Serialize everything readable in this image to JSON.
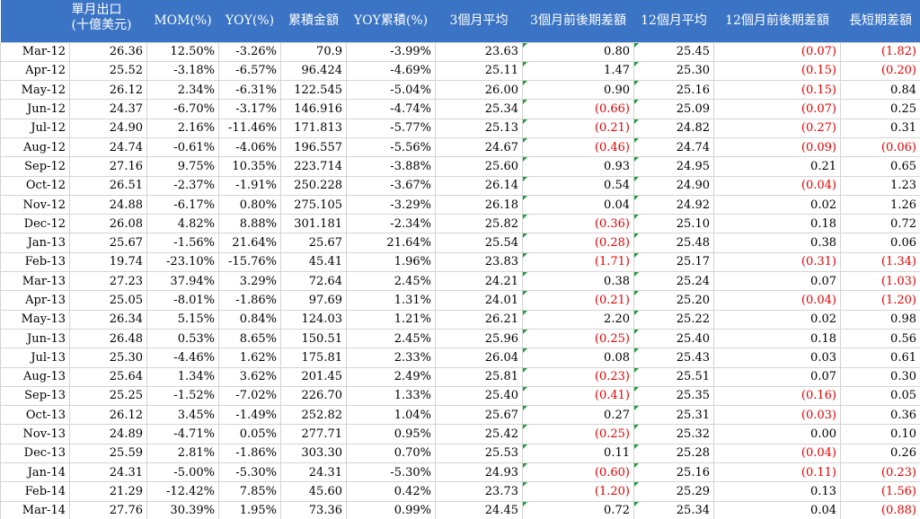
{
  "sheet": {
    "headers": [
      "",
      [
        "單月出口",
        "(十億美元)"
      ],
      "MOM(%)",
      "YOY(%)",
      "累積金額",
      "YOY累積(%)",
      "3個月平均",
      "3個月前後期差額",
      "12個月平均",
      "12個月前後期差額",
      "長短期差額"
    ],
    "colors": {
      "header_bg": "#3b74c4",
      "header_text": "#ffffff",
      "negative_text": "#e60000",
      "grid_line": "#d4d4d4",
      "error_flag": "#1f9d3a"
    },
    "rows": [
      [
        "Mar-12",
        "26.36",
        "12.50%",
        "-3.26%",
        "70.9",
        "-3.99%",
        "23.63",
        "0.80",
        "25.45",
        "(0.07)",
        "(1.82)"
      ],
      [
        "Apr-12",
        "25.52",
        "-3.18%",
        "-6.57%",
        "96.424",
        "-4.69%",
        "25.11",
        "1.47",
        "25.30",
        "(0.15)",
        "(0.20)"
      ],
      [
        "May-12",
        "26.12",
        "2.34%",
        "-6.31%",
        "122.545",
        "-5.04%",
        "26.00",
        "0.90",
        "25.16",
        "(0.15)",
        "0.84"
      ],
      [
        "Jun-12",
        "24.37",
        "-6.70%",
        "-3.17%",
        "146.916",
        "-4.74%",
        "25.34",
        "(0.66)",
        "25.09",
        "(0.07)",
        "0.25"
      ],
      [
        "Jul-12",
        "24.90",
        "2.16%",
        "-11.46%",
        "171.813",
        "-5.77%",
        "25.13",
        "(0.21)",
        "24.82",
        "(0.27)",
        "0.31"
      ],
      [
        "Aug-12",
        "24.74",
        "-0.61%",
        "-4.06%",
        "196.557",
        "-5.56%",
        "24.67",
        "(0.46)",
        "24.74",
        "(0.09)",
        "(0.06)"
      ],
      [
        "Sep-12",
        "27.16",
        "9.75%",
        "10.35%",
        "223.714",
        "-3.88%",
        "25.60",
        "0.93",
        "24.95",
        "0.21",
        "0.65"
      ],
      [
        "Oct-12",
        "26.51",
        "-2.37%",
        "-1.91%",
        "250.228",
        "-3.67%",
        "26.14",
        "0.54",
        "24.90",
        "(0.04)",
        "1.23"
      ],
      [
        "Nov-12",
        "24.88",
        "-6.17%",
        "0.80%",
        "275.105",
        "-3.29%",
        "26.18",
        "0.04",
        "24.92",
        "0.02",
        "1.26"
      ],
      [
        "Dec-12",
        "26.08",
        "4.82%",
        "8.88%",
        "301.181",
        "-2.34%",
        "25.82",
        "(0.36)",
        "25.10",
        "0.18",
        "0.72"
      ],
      [
        "Jan-13",
        "25.67",
        "-1.56%",
        "21.64%",
        "25.67",
        "21.64%",
        "25.54",
        "(0.28)",
        "25.48",
        "0.38",
        "0.06"
      ],
      [
        "Feb-13",
        "19.74",
        "-23.10%",
        "-15.76%",
        "45.41",
        "1.96%",
        "23.83",
        "(1.71)",
        "25.17",
        "(0.31)",
        "(1.34)"
      ],
      [
        "Mar-13",
        "27.23",
        "37.94%",
        "3.29%",
        "72.64",
        "2.45%",
        "24.21",
        "0.38",
        "25.24",
        "0.07",
        "(1.03)"
      ],
      [
        "Apr-13",
        "25.05",
        "-8.01%",
        "-1.86%",
        "97.69",
        "1.31%",
        "24.01",
        "(0.21)",
        "25.20",
        "(0.04)",
        "(1.20)"
      ],
      [
        "May-13",
        "26.34",
        "5.15%",
        "0.84%",
        "124.03",
        "1.21%",
        "26.21",
        "2.20",
        "25.22",
        "0.02",
        "0.98"
      ],
      [
        "Jun-13",
        "26.48",
        "0.53%",
        "8.65%",
        "150.51",
        "2.45%",
        "25.96",
        "(0.25)",
        "25.40",
        "0.18",
        "0.56"
      ],
      [
        "Jul-13",
        "25.30",
        "-4.46%",
        "1.62%",
        "175.81",
        "2.33%",
        "26.04",
        "0.08",
        "25.43",
        "0.03",
        "0.61"
      ],
      [
        "Aug-13",
        "25.64",
        "1.34%",
        "3.62%",
        "201.45",
        "2.49%",
        "25.81",
        "(0.23)",
        "25.51",
        "0.07",
        "0.30"
      ],
      [
        "Sep-13",
        "25.25",
        "-1.52%",
        "-7.02%",
        "226.70",
        "1.33%",
        "25.40",
        "(0.41)",
        "25.35",
        "(0.16)",
        "0.05"
      ],
      [
        "Oct-13",
        "26.12",
        "3.45%",
        "-1.49%",
        "252.82",
        "1.04%",
        "25.67",
        "0.27",
        "25.31",
        "(0.03)",
        "0.36"
      ],
      [
        "Nov-13",
        "24.89",
        "-4.71%",
        "0.05%",
        "277.71",
        "0.95%",
        "25.42",
        "(0.25)",
        "25.32",
        "0.00",
        "0.10"
      ],
      [
        "Dec-13",
        "25.59",
        "2.81%",
        "-1.86%",
        "303.30",
        "0.70%",
        "25.53",
        "0.11",
        "25.28",
        "(0.04)",
        "0.26"
      ],
      [
        "Jan-14",
        "24.31",
        "-5.00%",
        "-5.30%",
        "24.31",
        "-5.30%",
        "24.93",
        "(0.60)",
        "25.16",
        "(0.11)",
        "(0.23)"
      ],
      [
        "Feb-14",
        "21.29",
        "-12.42%",
        "7.85%",
        "45.60",
        "0.42%",
        "23.73",
        "(1.20)",
        "25.29",
        "0.13",
        "(1.56)"
      ],
      [
        "Mar-14",
        "27.76",
        "30.39%",
        "1.95%",
        "73.36",
        "0.99%",
        "24.45",
        "0.72",
        "25.34",
        "0.04",
        "(0.88)"
      ]
    ],
    "flagged_columns": [
      7,
      8
    ]
  }
}
